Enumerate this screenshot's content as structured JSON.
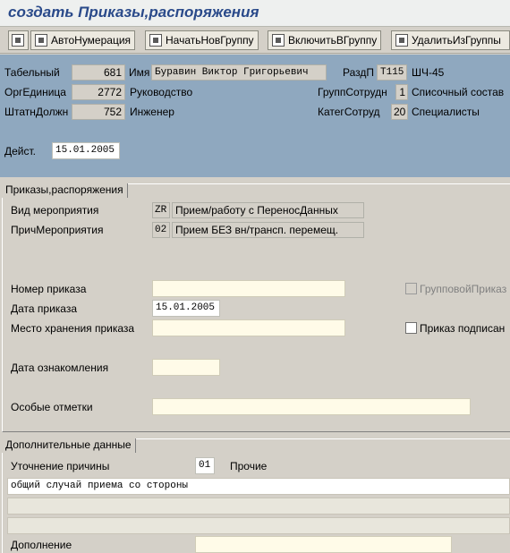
{
  "window": {
    "title": "создать Приказы,распоряжения"
  },
  "toolbar": {
    "buttons": [
      {
        "label": "",
        "icon": "edit-icon"
      },
      {
        "label": "АвтоНумерация",
        "icon": "auto-number-icon"
      },
      {
        "label": "НачатьНовГруппу",
        "icon": "new-group-icon"
      },
      {
        "label": "ВключитьВГруппу",
        "icon": "add-to-group-icon"
      },
      {
        "label": "УдалитьИзГруппы",
        "icon": "remove-from-group-icon"
      }
    ]
  },
  "header": {
    "tabel_label": "Табельный",
    "tabel_value": "681",
    "name_label": "Имя",
    "name_value": "Буравин Виктор Григорьевич",
    "razdp_label": "РаздП",
    "razdp_code": "T115",
    "razdp_text": "ШЧ-45",
    "org_label": "ОргЕдиница",
    "org_code": "2772",
    "org_text": "Руководство",
    "grupp_label": "ГруппСотрудн",
    "grupp_code": "1",
    "grupp_text": "Списочный состав",
    "shtat_label": "ШтатнДолжн",
    "shtat_code": "752",
    "shtat_text": "Инженер",
    "kateg_label": "КатегСотруд",
    "kateg_code": "20",
    "kateg_text": "Специалисты",
    "deist_label": "Дейст.",
    "deist_value": "15.01.2005"
  },
  "orders": {
    "section_title": "Приказы,распоряжения",
    "vid_label": "Вид мероприятия",
    "vid_code": "ZR",
    "vid_text": "Прием/работу с ПереносДанных",
    "prich_label": "ПричМероприятия",
    "prich_code": "02",
    "prich_text": "Прием БЕЗ вн/трансп. перемещ.",
    "nomer_label": "Номер приказа",
    "nomer_value": "",
    "data_label": "Дата приказа",
    "data_value": "15.01.2005",
    "mesto_label": "Место хранения приказа",
    "mesto_value": "",
    "oznak_label": "Дата ознакомления",
    "oznak_value": "",
    "osob_label": "Особые отметки",
    "osob_value": "",
    "group_order_label": "ГрупповойПриказ",
    "signed_label": "Приказ подписан"
  },
  "additional": {
    "section_title": "Дополнительные данные",
    "utoch_label": "Уточнение причины",
    "utoch_code": "01",
    "utoch_text": "Прочие",
    "text_lines": [
      "общий случай приема со стороны",
      "",
      ""
    ],
    "dopoln_label": "Дополнение",
    "dopoln_value": ""
  }
}
